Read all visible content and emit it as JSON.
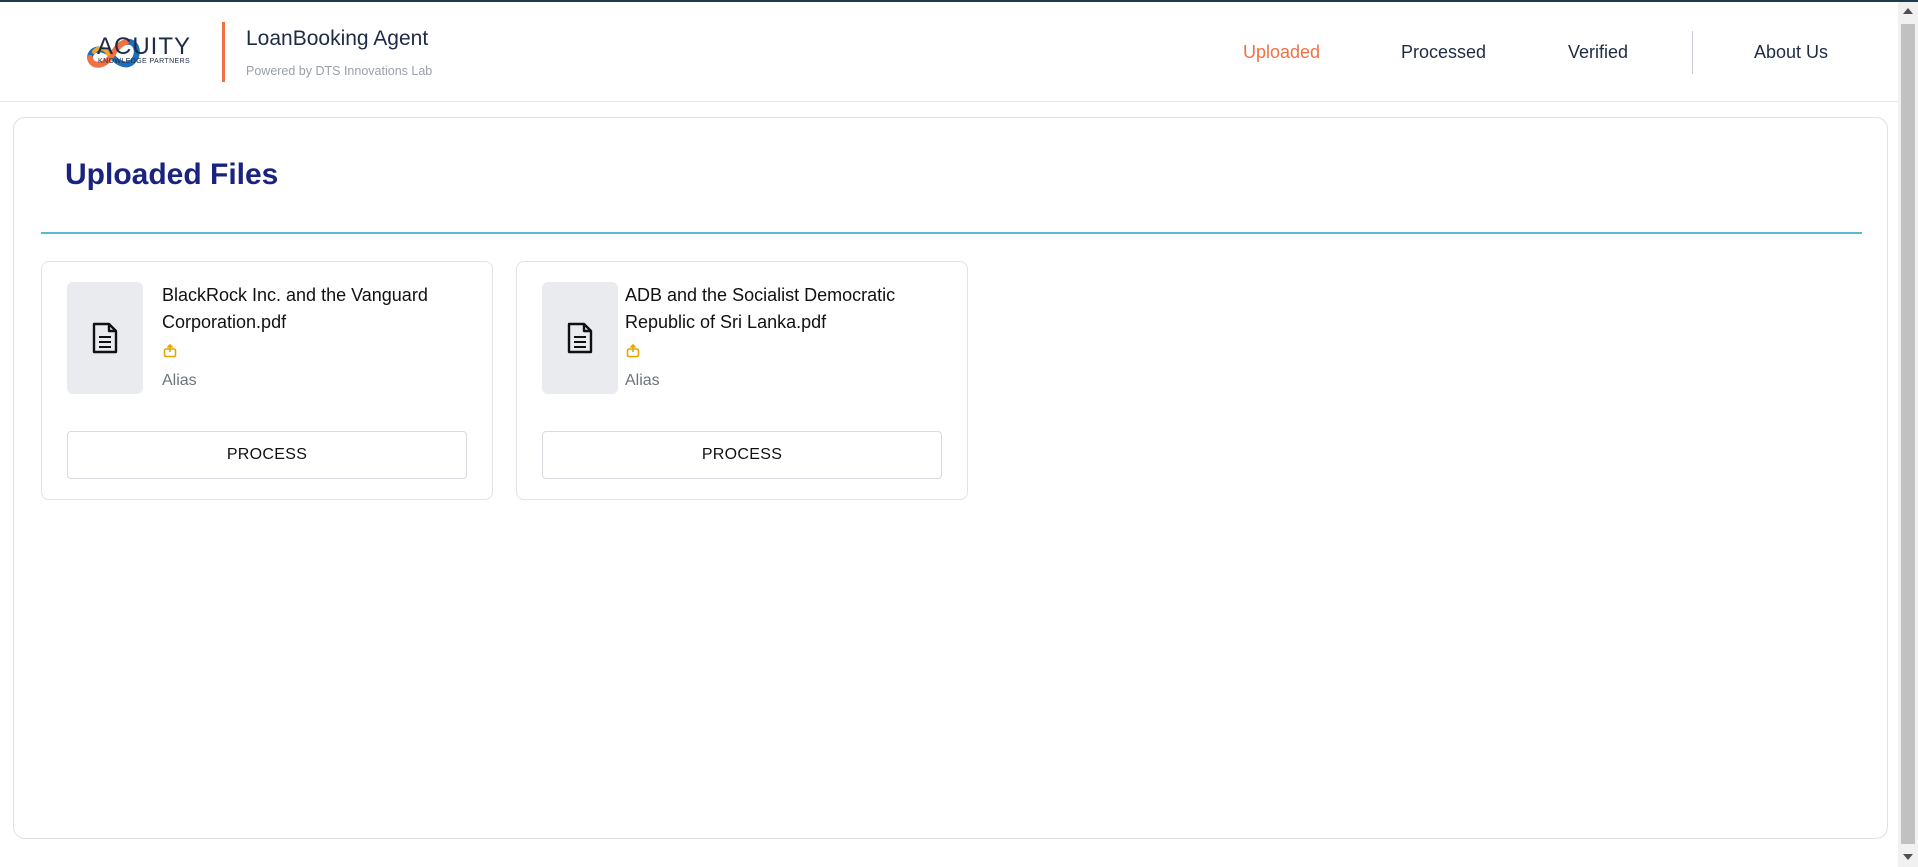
{
  "brand": {
    "logo_text": "ACUITY",
    "logo_sub": "KNOWLEDGE PARTNERS",
    "app_title": "LoanBooking Agent",
    "app_subtitle": "Powered by DTS Innovations Lab",
    "accent_color": "#f07143",
    "title_color": "#1a237e"
  },
  "nav": {
    "items": [
      {
        "label": "Uploaded",
        "active": true
      },
      {
        "label": "Processed",
        "active": false
      },
      {
        "label": "Verified",
        "active": false
      },
      {
        "label": "About Us",
        "active": false
      }
    ]
  },
  "main": {
    "title": "Uploaded Files",
    "files": [
      {
        "name": "BlackRock Inc. and the Vanguard Corporation.pdf",
        "alias_label": "Alias",
        "action_label": "PROCESS",
        "icon": "document-icon",
        "tag_icon": "tag-icon"
      },
      {
        "name": "ADB and the Socialist Democratic Republic of Sri Lanka.pdf",
        "alias_label": "Alias",
        "action_label": "PROCESS",
        "icon": "document-icon",
        "tag_icon": "tag-icon"
      }
    ]
  }
}
